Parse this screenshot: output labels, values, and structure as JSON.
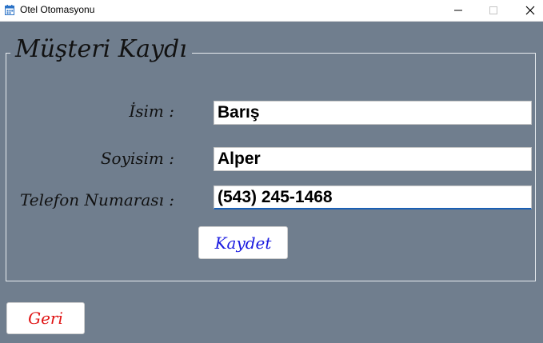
{
  "window": {
    "title": "Otel Otomasyonu",
    "minimize_glyph": "—",
    "maximize_glyph": "☐",
    "close_glyph": "✕",
    "icon": "calendar-icon"
  },
  "form": {
    "group_title": "Müşteri Kaydı",
    "fields": {
      "isim_label": "İsim :",
      "isim_value": "Barış",
      "soyisim_label": "Soyisim :",
      "soyisim_value": "Alper",
      "telefon_label": "Telefon Numarası :",
      "telefon_value": "(543) 245-1468"
    },
    "save_label": "Kaydet",
    "back_label": "Geri"
  },
  "colors": {
    "background": "#707e8e",
    "save_text": "#1a1ae0",
    "back_text": "#e01414",
    "focus_underline": "#1a5fb4"
  }
}
